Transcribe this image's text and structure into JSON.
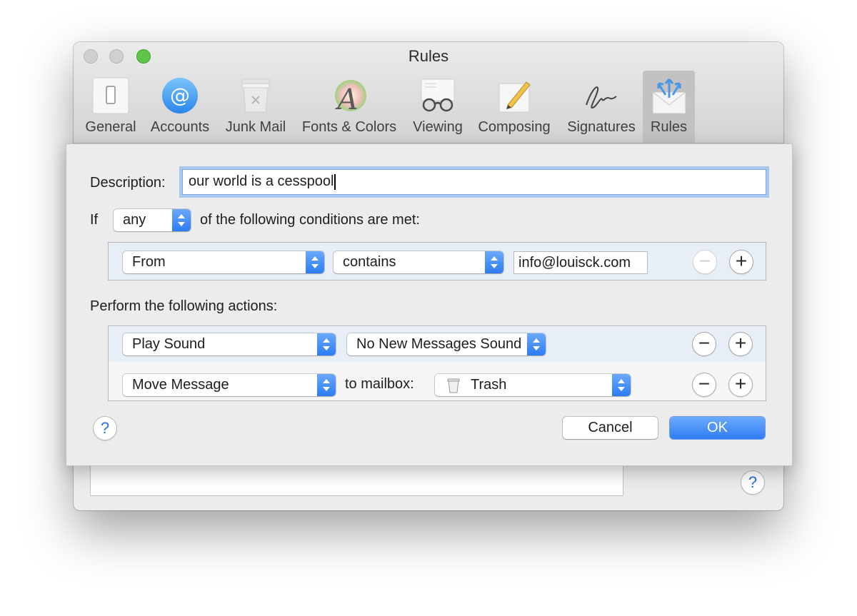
{
  "window": {
    "title": "Rules",
    "toolbar": [
      {
        "label": "General",
        "icon": "general-switch-icon"
      },
      {
        "label": "Accounts",
        "icon": "at-sign-icon"
      },
      {
        "label": "Junk Mail",
        "icon": "junk-mail-icon"
      },
      {
        "label": "Fonts & Colors",
        "icon": "fonts-colors-icon"
      },
      {
        "label": "Viewing",
        "icon": "glasses-icon"
      },
      {
        "label": "Composing",
        "icon": "pencil-paper-icon"
      },
      {
        "label": "Signatures",
        "icon": "signature-icon"
      },
      {
        "label": "Rules",
        "icon": "rules-envelope-icon",
        "selected": true
      }
    ],
    "help_label": "?"
  },
  "sheet": {
    "description_label": "Description:",
    "description_value": "our world is a cesspool",
    "if_label": "If",
    "match_value": "any",
    "conditions_suffix": "of the following conditions are met:",
    "conditions": [
      {
        "field": "From",
        "operator": "contains",
        "value": "info@louisck.com"
      }
    ],
    "actions_label": "Perform the following actions:",
    "actions": [
      {
        "action": "Play Sound",
        "param": "No New Messages Sound"
      },
      {
        "action": "Move Message",
        "param_label": "to mailbox:",
        "mailbox": "Trash"
      }
    ],
    "remove_label": "−",
    "add_label": "+",
    "help_label": "?",
    "cancel_label": "Cancel",
    "ok_label": "OK"
  },
  "colors": {
    "accent": "#2f7df4",
    "focus_ring": "#a9c8f0",
    "zoom_light": "#5ec548"
  }
}
